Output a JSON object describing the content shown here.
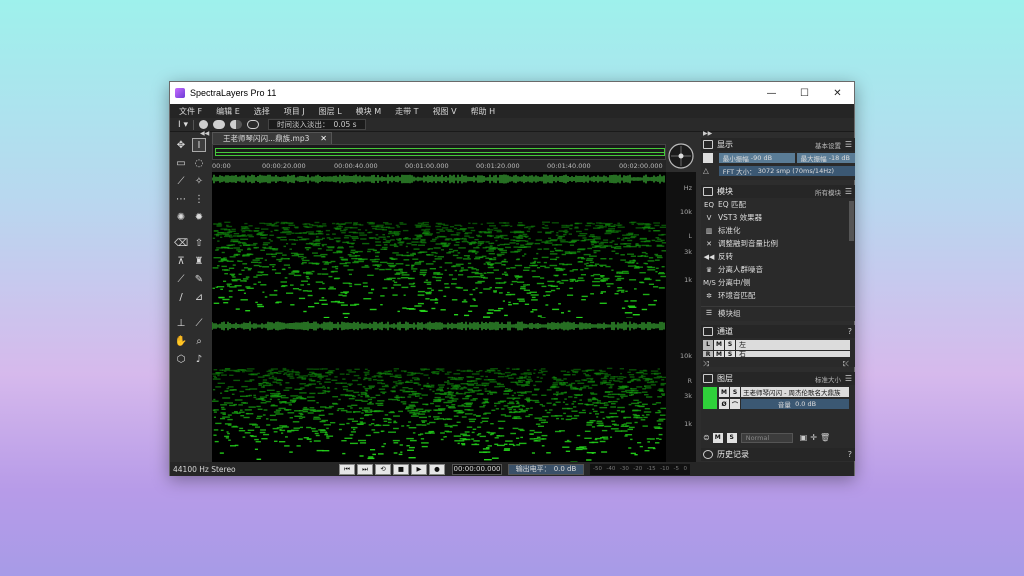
{
  "window": {
    "title": "SpectraLayers Pro 11",
    "minimize": "—",
    "maximize": "☐",
    "close": "✕"
  },
  "menu": [
    "文件 F",
    "编辑 E",
    "选择",
    "项目 J",
    "图层 L",
    "模块 M",
    "走带 T",
    "视图 V",
    "帮助 H"
  ],
  "toolbar": {
    "fade_label": "时间淡入淡出：",
    "fade_value": "0.05 s",
    "cursor_icon": "I-beam-icon"
  },
  "document": {
    "tab_name": "王老师琴闪闪...鼎族.mp3",
    "close": "✕"
  },
  "ruler": [
    "00:00",
    "00:00:20.000",
    "00:00:40.000",
    "00:01:00.000",
    "00:01:20.000",
    "00:01:40.000",
    "00:02:00.000"
  ],
  "freq_axis": {
    "unit": "Hz",
    "top": [
      "10k",
      "3k",
      "1k"
    ],
    "bottom": [
      "10k",
      "3k",
      "1k"
    ],
    "ch_top": "L",
    "ch_bottom": "R"
  },
  "status": {
    "sample_rate": "44100 Hz Stereo",
    "transport": [
      "⏮",
      "⏭",
      "⟲",
      "■",
      "▶",
      "●"
    ],
    "time": "00:00:00.000",
    "output_label": "输出电平：",
    "output_value": "0.0 dB",
    "meter_ticks": [
      "-50",
      "-40",
      "-30",
      "-20",
      "-15",
      "-10",
      "-5",
      "0"
    ]
  },
  "display_panel": {
    "title": "显示",
    "preset": "基本设置",
    "min_label": "最小振幅",
    "min_value": "-90 dB",
    "max_label": "最大振幅",
    "max_value": "-18 dB",
    "fft_label": "FFT 大小：",
    "fft_value": "3072 smp (70ms/14Hz)"
  },
  "modules_panel": {
    "title": "模块",
    "filter": "所有模块",
    "items": [
      {
        "icon": "EQ",
        "label": "EQ 匹配"
      },
      {
        "icon": "V",
        "label": "VST3 效果器"
      },
      {
        "icon": "▥",
        "label": "标准化"
      },
      {
        "icon": "✕",
        "label": "调整融到音量比例"
      },
      {
        "icon": "◀◀",
        "label": "反转"
      },
      {
        "icon": "♛",
        "label": "分离人群噪音"
      },
      {
        "icon": "M/S",
        "label": "分离中/侧"
      },
      {
        "icon": "✲",
        "label": "环境音匹配"
      }
    ],
    "footer": "模块组"
  },
  "channels_panel": {
    "title": "通道",
    "rows": [
      {
        "tag": "L",
        "m": "M",
        "s": "S",
        "name": "左"
      },
      {
        "tag": "R",
        "m": "M",
        "s": "S",
        "name": "右"
      }
    ]
  },
  "layers_panel": {
    "title": "图层",
    "size": "标准大小",
    "layer_name": "王老师琴闪闪 - 周杰伦歌名大鼎族",
    "volume_label": "音量",
    "volume_value": "0.0 dB",
    "m": "M",
    "s": "S",
    "blend": "Normal"
  },
  "history_panel": {
    "title": "历史记录"
  },
  "colors": {
    "accent_green": "#46c93b",
    "level_blue": "#3b5873",
    "panel_bg": "#2a2a2a"
  }
}
